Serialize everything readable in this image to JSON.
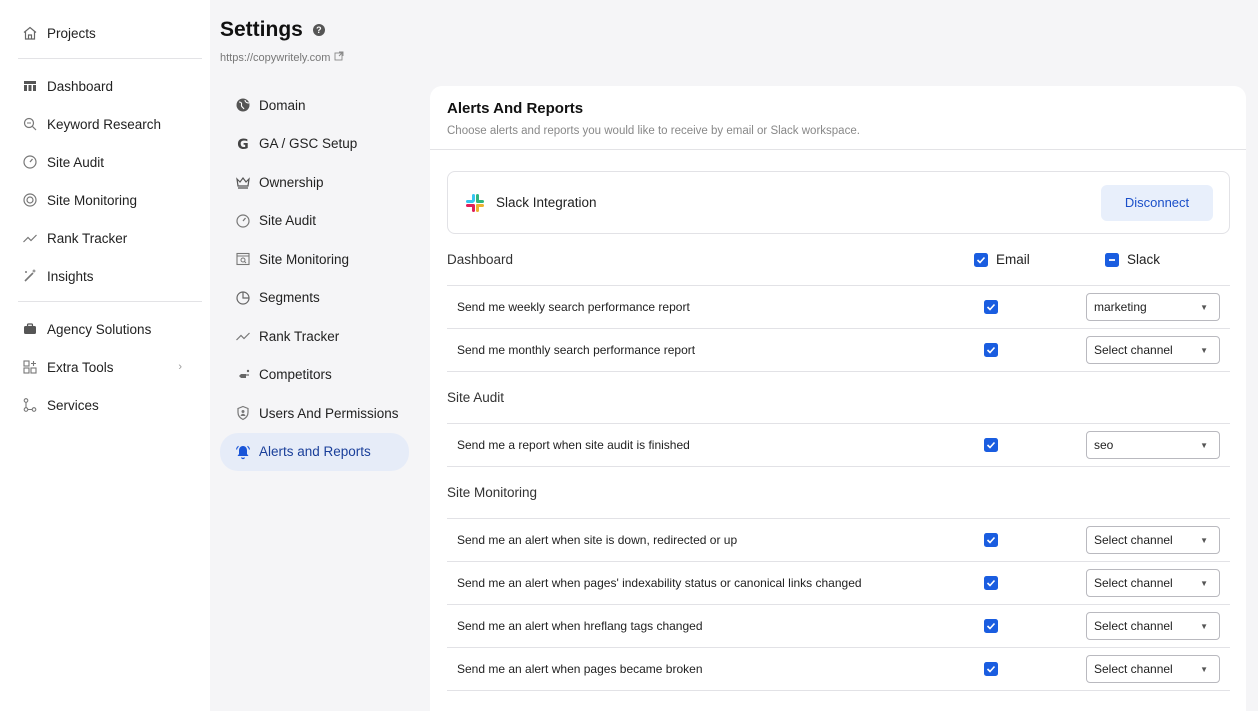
{
  "sidebar": {
    "top": [
      {
        "label": "Projects",
        "icon": "home-icon"
      }
    ],
    "main": [
      {
        "label": "Dashboard",
        "icon": "dashboard-icon"
      },
      {
        "label": "Keyword Research",
        "icon": "keyword-icon"
      },
      {
        "label": "Site Audit",
        "icon": "gauge-icon"
      },
      {
        "label": "Site Monitoring",
        "icon": "monitor-icon"
      },
      {
        "label": "Rank Tracker",
        "icon": "trend-icon"
      },
      {
        "label": "Insights",
        "icon": "wand-icon"
      }
    ],
    "bottom": [
      {
        "label": "Agency Solutions",
        "icon": "briefcase-icon"
      },
      {
        "label": "Extra Tools",
        "icon": "grid-plus-icon",
        "chevron": "›"
      },
      {
        "label": "Services",
        "icon": "flow-icon"
      }
    ]
  },
  "header": {
    "title": "Settings",
    "help": "?",
    "url": "https://copywritely.com"
  },
  "subnav": [
    {
      "label": "Domain",
      "icon": "globe-icon",
      "active": false
    },
    {
      "label": "GA / GSC Setup",
      "icon": "google-icon",
      "active": false
    },
    {
      "label": "Ownership",
      "icon": "crown-icon",
      "active": false
    },
    {
      "label": "Site Audit",
      "icon": "gauge-icon",
      "active": false
    },
    {
      "label": "Site Monitoring",
      "icon": "monitor-search-icon",
      "active": false
    },
    {
      "label": "Segments",
      "icon": "pie-icon",
      "active": false
    },
    {
      "label": "Rank Tracker",
      "icon": "trend-icon",
      "active": false
    },
    {
      "label": "Competitors",
      "icon": "competitors-icon",
      "active": false
    },
    {
      "label": "Users And Permissions",
      "icon": "shield-user-icon",
      "active": false
    },
    {
      "label": "Alerts and Reports",
      "icon": "bell-icon",
      "active": true
    }
  ],
  "card": {
    "title": "Alerts And Reports",
    "subtitle": "Choose alerts and reports you would like to receive by email or Slack workspace.",
    "slack": {
      "label": "Slack Integration",
      "button": "Disconnect"
    },
    "columns": {
      "email": "Email",
      "slack": "Slack"
    },
    "sections": [
      {
        "title": "Dashboard",
        "rows": [
          {
            "label": "Send me weekly search performance report",
            "email": true,
            "channel": "marketing"
          },
          {
            "label": "Send me monthly search performance report",
            "email": true,
            "channel": "Select channel"
          }
        ]
      },
      {
        "title": "Site Audit",
        "rows": [
          {
            "label": "Send me a report when site audit is finished",
            "email": true,
            "channel": "seo"
          }
        ]
      },
      {
        "title": "Site Monitoring",
        "rows": [
          {
            "label": "Send me an alert when site is down, redirected or up",
            "email": true,
            "channel": "Select channel"
          },
          {
            "label": "Send me an alert when pages' indexability status or canonical links changed",
            "email": true,
            "channel": "Select channel"
          },
          {
            "label": "Send me an alert when hreflang tags changed",
            "email": true,
            "channel": "Select channel"
          },
          {
            "label": "Send me an alert when pages became broken",
            "email": true,
            "channel": "Select channel"
          }
        ]
      }
    ]
  },
  "colors": {
    "accent": "#1a5de0",
    "active_bg": "#e6ecf8",
    "button_bg": "#e8effb"
  }
}
